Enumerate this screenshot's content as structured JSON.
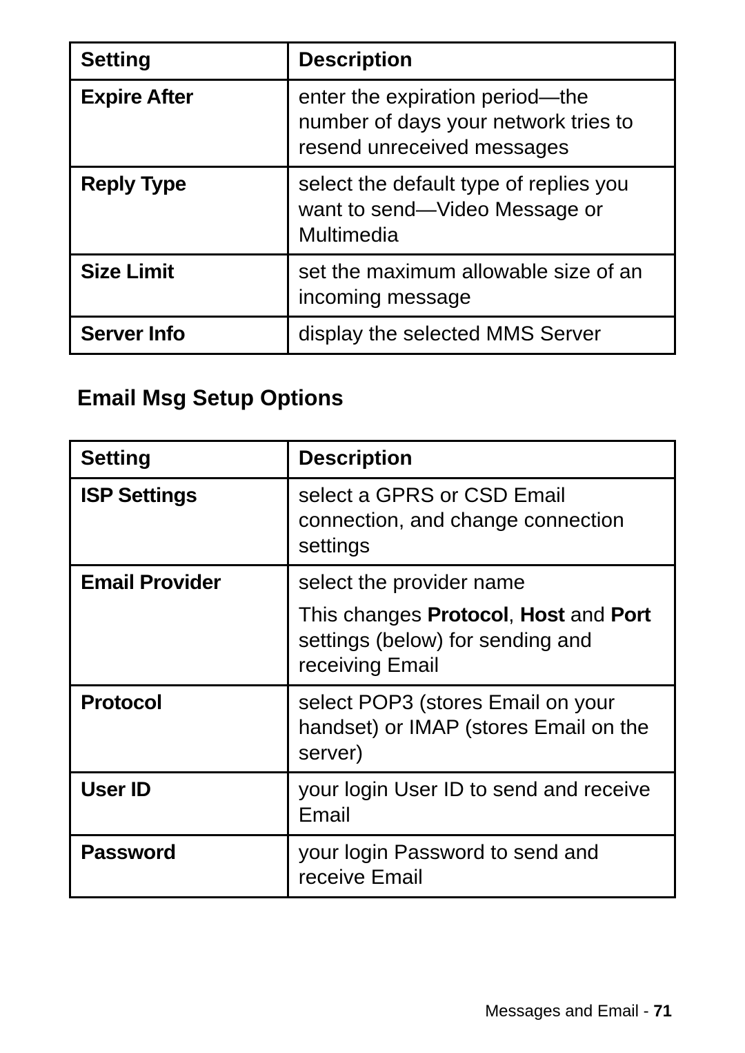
{
  "table1": {
    "headers": {
      "setting": "Setting",
      "description": "Description"
    },
    "rows": [
      {
        "setting": "Expire After",
        "description": "enter the expiration period—the number of days your network tries to resend unreceived messages"
      },
      {
        "setting": "Reply Type",
        "description": "select the default type of replies you want to send—Video Message or Multimedia"
      },
      {
        "setting": "Size Limit",
        "description": "set the maximum allowable size of an incoming message"
      },
      {
        "setting": "Server Info",
        "description": "display the selected MMS Server"
      }
    ]
  },
  "section_heading": "Email Msg Setup Options",
  "table2": {
    "headers": {
      "setting": "Setting",
      "description": "Description"
    },
    "rows": [
      {
        "setting": "ISP Settings",
        "description": "select a GPRS or CSD Email connection, and change connection settings"
      },
      {
        "setting": "Email Provider",
        "description": "select the provider name",
        "description2": {
          "pre": "This changes ",
          "b1": "Protocol",
          "sep1": ", ",
          "b2": "Host",
          "mid": " and ",
          "b3": "Port",
          "post": " settings (below) for sending and receiving Email"
        }
      },
      {
        "setting": "Protocol",
        "description": "select POP3 (stores Email on your handset) or IMAP (stores Email on the server)"
      },
      {
        "setting": "User ID",
        "description": "your login User ID to send and receive Email"
      },
      {
        "setting": "Password",
        "description": "your login Password to send and receive Email"
      }
    ]
  },
  "footer": {
    "section": "Messages and Email",
    "sep": " - ",
    "page": "71"
  }
}
